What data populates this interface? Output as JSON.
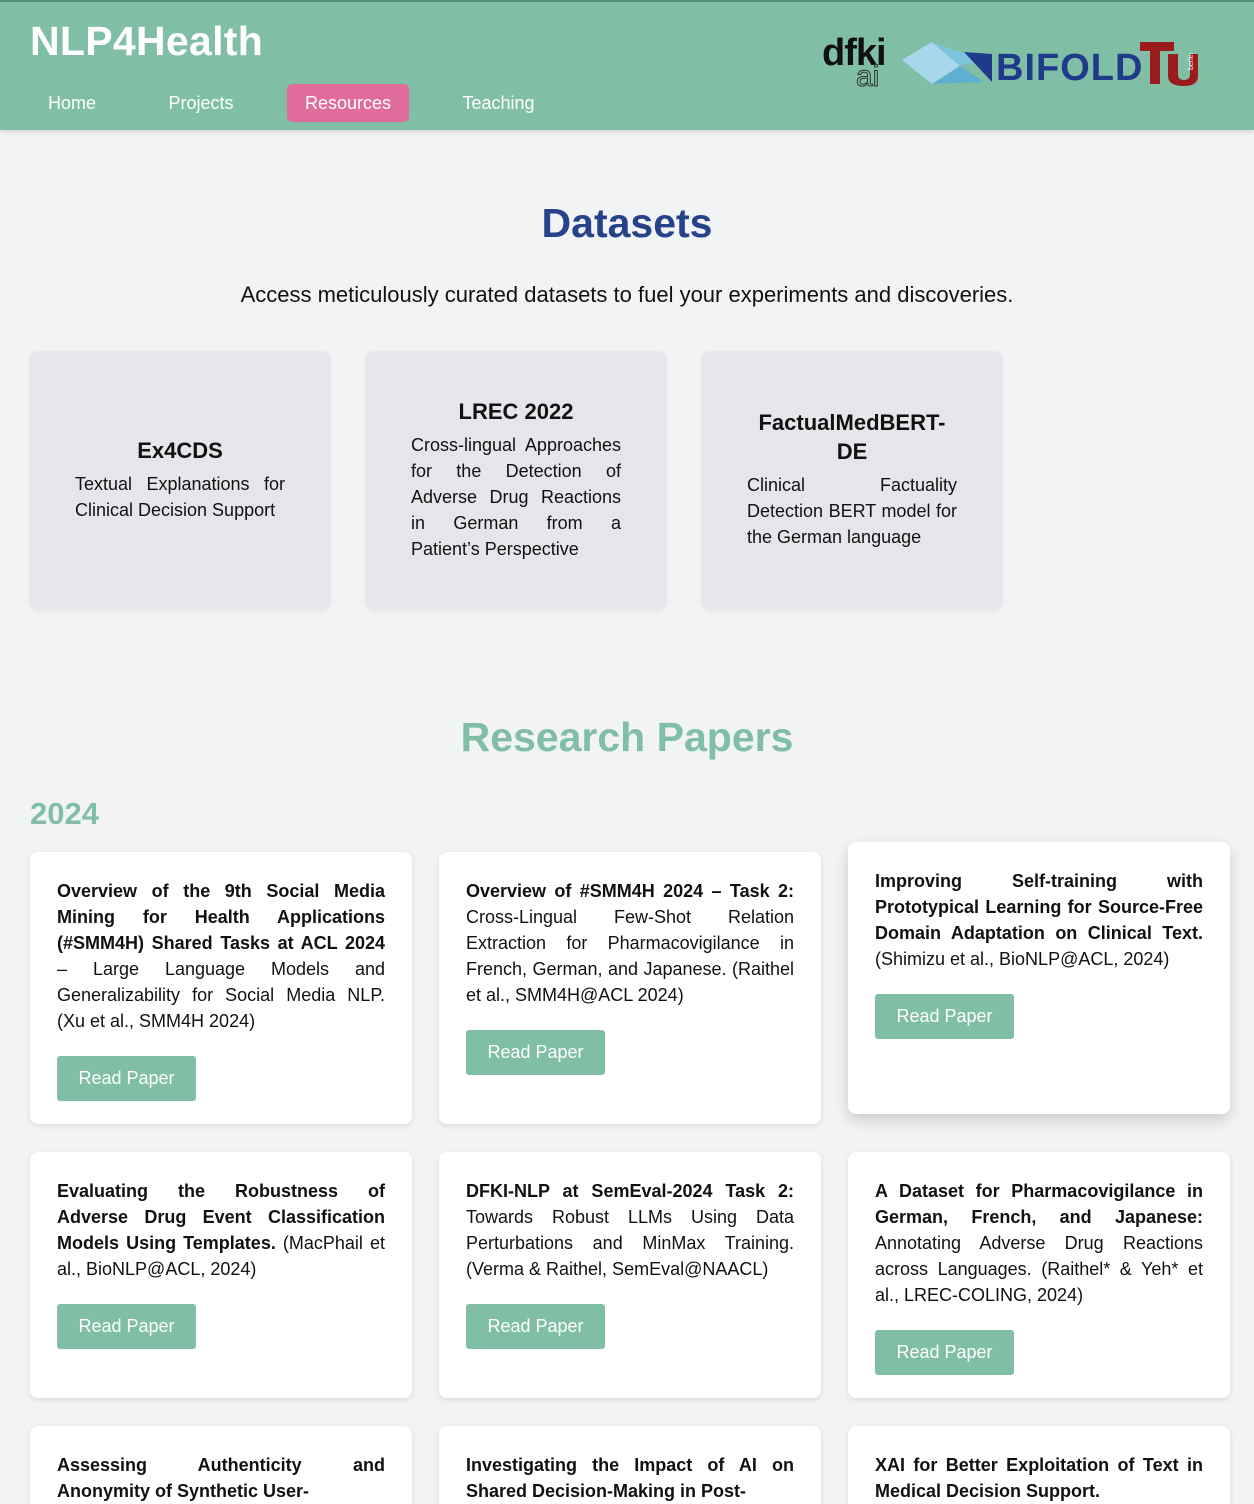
{
  "header": {
    "brand": "NLP4Health",
    "nav": [
      {
        "label": "Home"
      },
      {
        "label": "Projects"
      },
      {
        "label": "Resources",
        "active": true
      },
      {
        "label": "Teaching"
      }
    ],
    "logos": {
      "dfki_word": "dfki",
      "dfki_ai": "ai",
      "bifold": "BIFOLD",
      "tu_small": "berlin"
    }
  },
  "datasets": {
    "title": "Datasets",
    "subtitle": "Access meticulously curated datasets to fuel your experiments and discoveries.",
    "cards": [
      {
        "title": "Ex4CDS",
        "desc": "Textual Explanations for Clinical Decision Support"
      },
      {
        "title": "LREC 2022",
        "desc": "Cross-lingual Approaches for the Detection of Adverse Drug Reactions in German from a Patient’s Perspective"
      },
      {
        "title": "FactualMedBERT-DE",
        "desc": "Clinical Factuality Detection BERT model for the German language"
      }
    ]
  },
  "papers": {
    "title": "Research Papers",
    "year": "2024",
    "button_label": "Read Paper",
    "items": [
      {
        "bold": "Overview of the 9th Social Media Mining for Health Applications (#SMM4H) Shared Tasks at ACL 2024",
        "rest": " – Large Language Models and Generalizability for Social Media NLP. (Xu et al., SMM4H 2024)"
      },
      {
        "bold": "Overview of #SMM4H 2024 – Task 2:",
        "rest": " Cross-Lingual Few-Shot Relation Extraction for Pharmacovigilance in French, German, and Japanese. (Raithel et al., SMM4H@ACL 2024)"
      },
      {
        "bold": "Improving Self-training with Prototypical Learning for Source-Free Domain Adaptation on Clinical Text.",
        "rest": " (Shimizu et al., BioNLP@ACL, 2024)"
      },
      {
        "bold": "Evaluating the Robustness of Adverse Drug Event Classification Models Using Templates.",
        "rest": " (MacPhail et al., BioNLP@ACL, 2024)"
      },
      {
        "bold": "DFKI-NLP at SemEval-2024 Task 2:",
        "rest": " Towards Robust LLMs Using Data Perturbations and MinMax Training. (Verma & Raithel, SemEval@NAACL)"
      },
      {
        "bold": "A Dataset for Pharmacovigilance in German, French, and Japanese:",
        "rest": " Annotating Adverse Drug Reactions across Languages. (Raithel* & Yeh* et al., LREC-COLING, 2024)"
      },
      {
        "bold": "Assessing Authenticity and Anonymity of Synthetic User-",
        "rest": ""
      },
      {
        "bold": "Investigating the Impact of AI on Shared Decision-Making in Post-",
        "rest": ""
      },
      {
        "bold": "XAI for Better Exploitation of Text in Medical Decision Support.",
        "rest": ""
      }
    ]
  }
}
